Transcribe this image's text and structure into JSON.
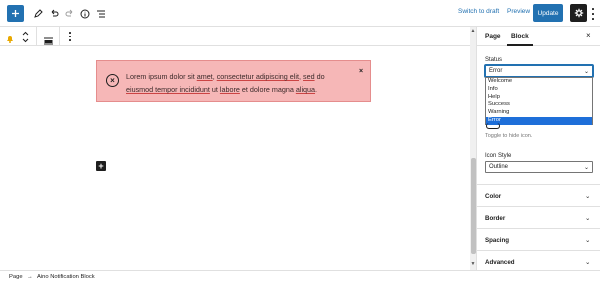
{
  "topbar": {
    "add_block": "plus-icon",
    "tools": "pencil-icon",
    "undo": "undo-icon",
    "redo": "redo-icon",
    "details": "info-icon",
    "outline": "list-view-icon",
    "switch_to_draft": "Switch to draft",
    "preview": "Preview",
    "update": "Update"
  },
  "notice": {
    "text_parts": [
      "Lorem ipsum dolor sit ",
      "amet",
      ", ",
      "consectetur adipiscing elit",
      ", ",
      "sed",
      " do ",
      "eiusmod tempor incididunt",
      " ut ",
      "labore",
      " et dolore magna ",
      "aliqua",
      "."
    ],
    "icon": "×",
    "close": "×"
  },
  "canvas": {
    "add_block": "+"
  },
  "sidebar": {
    "tabs": [
      "Page",
      "Block"
    ],
    "close": "×",
    "status_label": "Status",
    "status_value": "Error",
    "status_options": [
      "Welcome",
      "Info",
      "Help",
      "Success",
      "Warning",
      "Error"
    ],
    "toggle_help": "Toggle to hide icon.",
    "icon_style_label": "Icon Style",
    "icon_style_value": "Outline",
    "panels": [
      "Color",
      "Border",
      "Spacing",
      "Advanced"
    ],
    "chevron": "⌄"
  },
  "footer": {
    "crumb_root": "Page",
    "crumb_sep": "→",
    "crumb_current": "Aino Notification Block"
  },
  "colors": {
    "accent": "#2271b1",
    "notice_bg": "#f6b7b7",
    "notice_border": "#e58d8d",
    "selected_option": "#1e6fd9"
  }
}
